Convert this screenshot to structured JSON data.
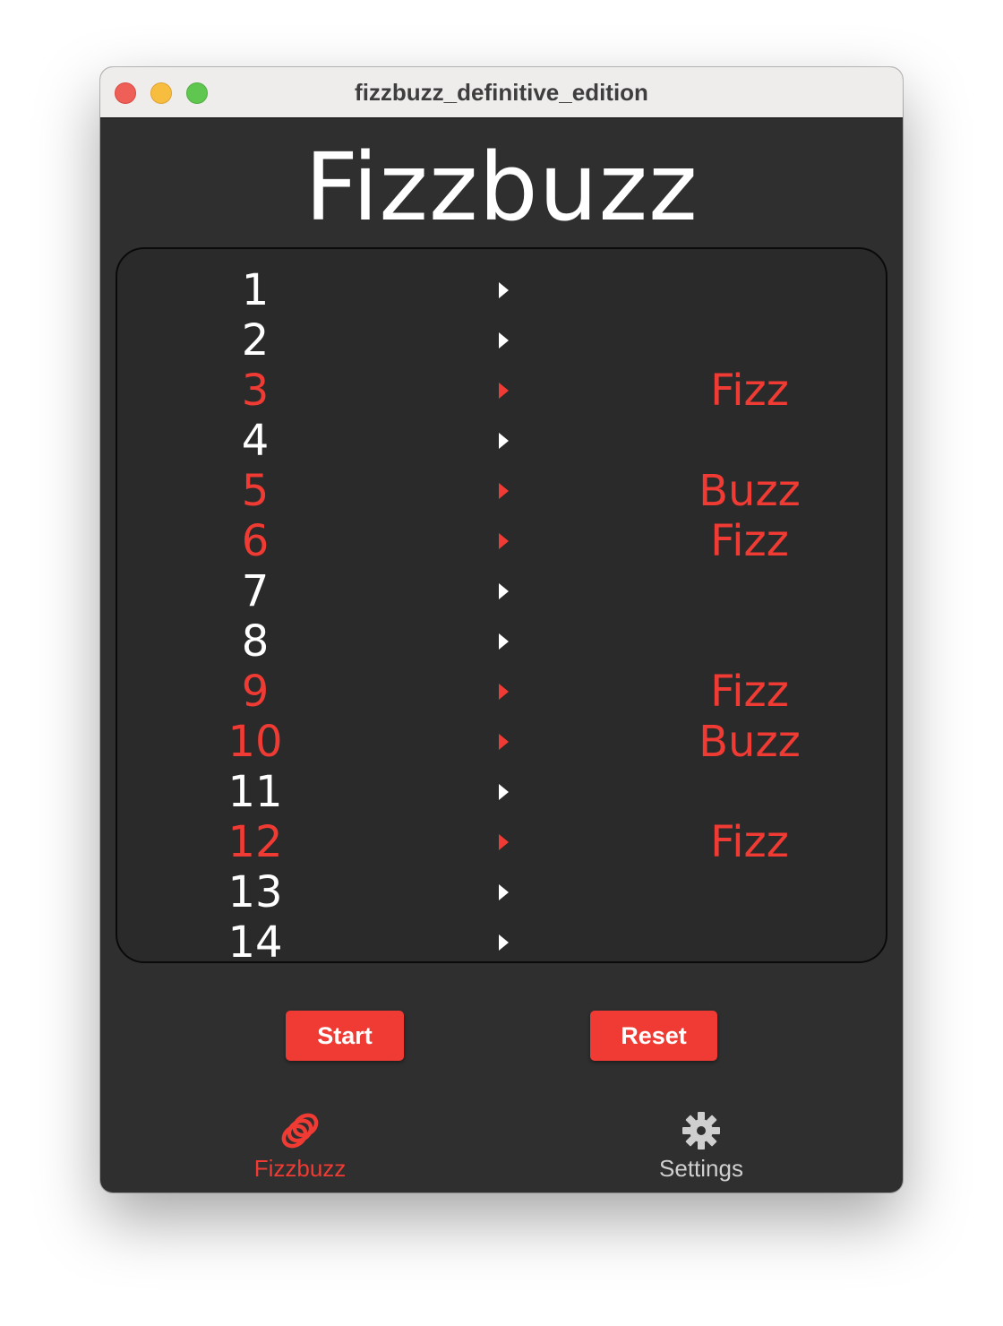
{
  "window": {
    "title": "fizzbuzz_definitive_edition"
  },
  "page": {
    "title": "Fizzbuzz"
  },
  "colors": {
    "accent": "#ef3b33",
    "background": "#2f2f2f",
    "panel": "#2a2a2a",
    "text": "#ffffff"
  },
  "rows": [
    {
      "number": "1",
      "result": "",
      "hit": false
    },
    {
      "number": "2",
      "result": "",
      "hit": false
    },
    {
      "number": "3",
      "result": "Fizz",
      "hit": true
    },
    {
      "number": "4",
      "result": "",
      "hit": false
    },
    {
      "number": "5",
      "result": "Buzz",
      "hit": true
    },
    {
      "number": "6",
      "result": "Fizz",
      "hit": true
    },
    {
      "number": "7",
      "result": "",
      "hit": false
    },
    {
      "number": "8",
      "result": "",
      "hit": false
    },
    {
      "number": "9",
      "result": "Fizz",
      "hit": true
    },
    {
      "number": "10",
      "result": "Buzz",
      "hit": true
    },
    {
      "number": "11",
      "result": "",
      "hit": false
    },
    {
      "number": "12",
      "result": "Fizz",
      "hit": true
    },
    {
      "number": "13",
      "result": "",
      "hit": false
    },
    {
      "number": "14",
      "result": "",
      "hit": false
    }
  ],
  "buttons": {
    "start_label": "Start",
    "reset_label": "Reset"
  },
  "tabs": [
    {
      "label": "Fizzbuzz",
      "icon": "rings-icon",
      "active": true
    },
    {
      "label": "Settings",
      "icon": "gear-icon",
      "active": false
    }
  ]
}
